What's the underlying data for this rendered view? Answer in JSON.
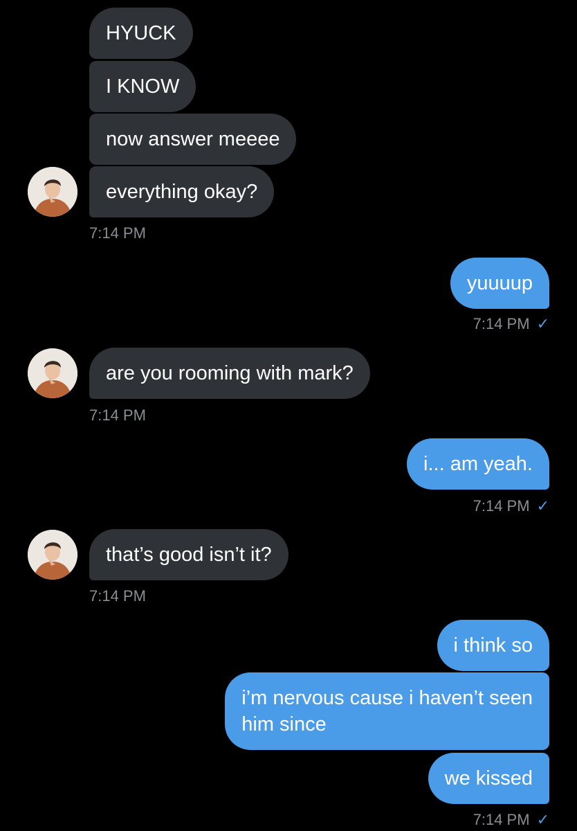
{
  "messages": [
    {
      "text": "HYUCK"
    },
    {
      "text": "I KNOW"
    },
    {
      "text": "now answer meeee"
    },
    {
      "text": "everything okay?"
    },
    {
      "text": "yuuuup"
    },
    {
      "text": "are you rooming with mark?"
    },
    {
      "text": "i... am yeah."
    },
    {
      "text": "that’s good isn’t it?"
    },
    {
      "text": "i think so"
    },
    {
      "text": "i’m nervous cause i haven’t seen\nhim since"
    },
    {
      "text": "we kissed"
    }
  ],
  "timestamps": [
    {
      "text": "7:14 PM"
    },
    {
      "text": "7:14 PM",
      "read": "✓"
    },
    {
      "text": "7:14 PM"
    },
    {
      "text": "7:14 PM",
      "read": "✓"
    },
    {
      "text": "7:14 PM"
    },
    {
      "text": "7:14 PM",
      "read": "✓"
    }
  ],
  "colors": {
    "background": "#000000",
    "received_bubble": "#2f3236",
    "sent_bubble": "#4a9be8",
    "timestamp": "#8a8d91",
    "read_check": "#4a9be8"
  },
  "icons": {
    "avatar": "contact-avatar",
    "read_receipt": "checkmark-icon"
  }
}
